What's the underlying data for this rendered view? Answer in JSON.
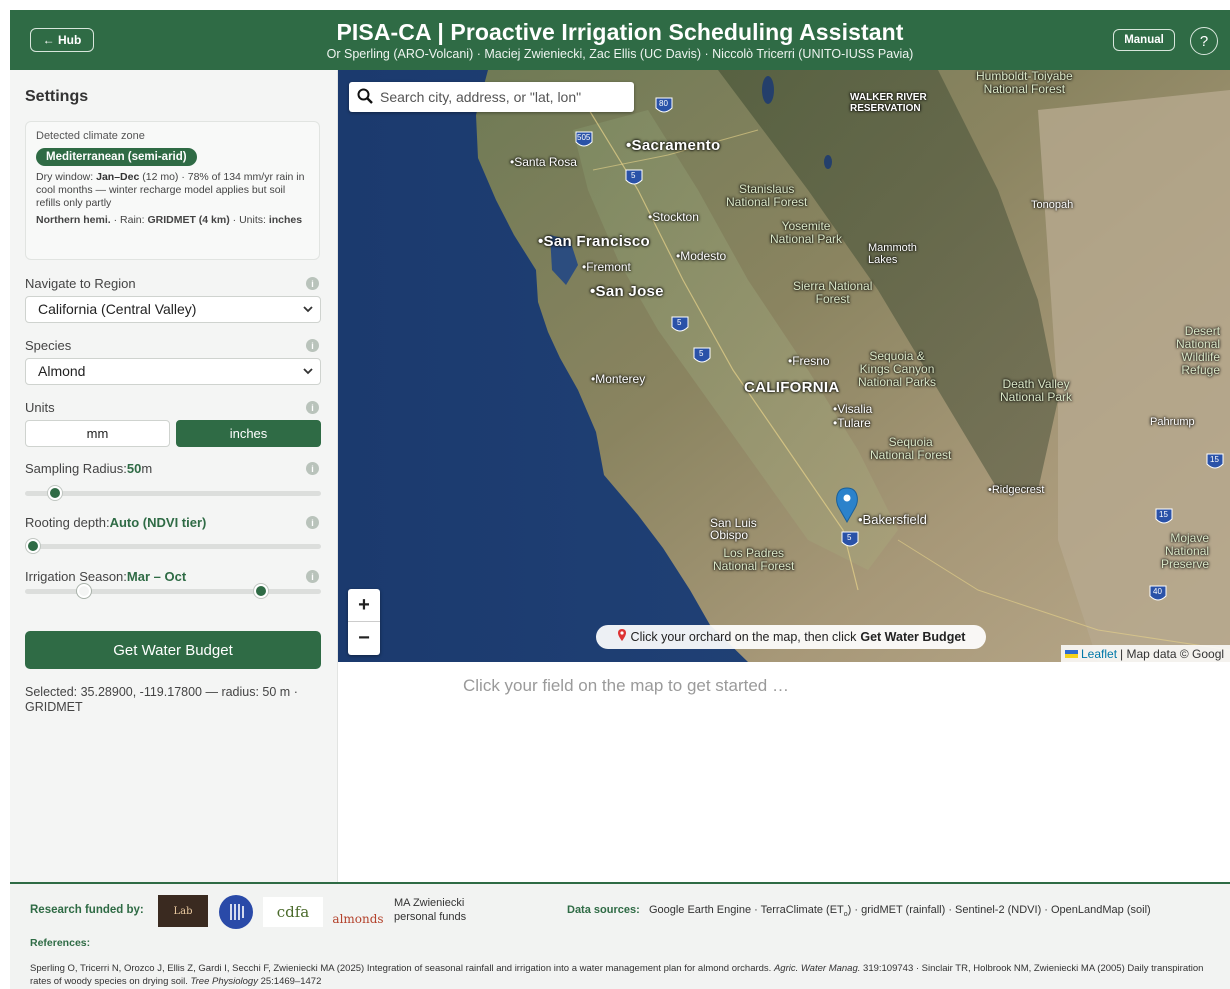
{
  "header": {
    "hub_label": "← Hub",
    "title": "PISA-CA | Proactive Irrigation Scheduling Assistant",
    "subtitle": "Or Sperling (ARO-Volcani) · Maciej Zwieniecki, Zac Ellis (UC Davis) · Niccolò Tricerri (UNITO-IUSS Pavia)",
    "manual_label": "Manual",
    "help_label": "?"
  },
  "sidebar": {
    "title": "Settings",
    "climate": {
      "label": "Detected climate zone",
      "zone": "Mediterranean (semi-arid)",
      "dry_window_label": "Dry window:",
      "dry_window_value": "Jan–Dec",
      "description": "(12 mo) · 78% of 134 mm/yr rain in cool months — winter recharge model applies but soil refills only partly",
      "hemisphere": "Northern hemi.",
      "rain_label": "· Rain:",
      "rain_value": "GRIDMET (4 km)",
      "units_label": "· Units:",
      "units_value": "inches"
    },
    "region": {
      "label": "Navigate to Region",
      "value": "California (Central Valley)"
    },
    "species": {
      "label": "Species",
      "value": "Almond"
    },
    "units": {
      "label": "Units",
      "options": [
        "mm",
        "inches"
      ],
      "selected": "inches"
    },
    "sampling": {
      "label": "Sampling Radius:",
      "value": "50",
      "unit": "m",
      "level": 0.1
    },
    "rooting": {
      "label": "Rooting depth:",
      "value": "Auto (NDVI tier)",
      "level": 0.0
    },
    "season": {
      "label": "Irrigation Season:",
      "value": "Mar – Oct",
      "start_level": 0.18,
      "end_level": 0.82
    },
    "info_glyph": "i",
    "get_button": "Get Water Budget",
    "selected_text": "Selected: 35.28900, -119.17800 — radius: 50 m · GRIDMET"
  },
  "map": {
    "search_placeholder": "Search city, address, or \"lat, lon\"",
    "zoom_in": "+",
    "zoom_out": "−",
    "hint_prefix": "Click your orchard on the map, then click",
    "hint_bold": "Get Water Budget",
    "attribution_leaflet": "Leaflet",
    "attribution_data": "| Map data © Googl",
    "labels": {
      "sacramento": "•Sacramento",
      "santa_rosa": "•Santa Rosa",
      "stockton": "•Stockton",
      "san_francisco": "•San Francisco",
      "modesto": "•Modesto",
      "fremont": "•Fremont",
      "san_jose": "•San Jose",
      "monterey": "•Monterey",
      "fresno": "•Fresno",
      "california": "CALIFORNIA",
      "visalia": "•Visalia",
      "tulare": "•Tulare",
      "bakersfield": "•Bakersfield",
      "san_luis_obispo": "San Luis\nObispo",
      "los_padres": "Los Padres\nNational Forest",
      "stanislaus": "Stanislaus\nNational Forest",
      "yosemite": "Yosemite\nNational Park",
      "mammoth": "Mammoth\nLakes",
      "sierra": "Sierra National\nForest",
      "sequoia_kings": "Sequoia &\nKings Canyon\nNational Parks",
      "sequoia_nf": "Sequoia\nNational Forest",
      "death_valley": "Death Valley\nNational Park",
      "walker_river": "WALKER RIVER\nRESERVATION",
      "humboldt": "Humboldt-Toiyabe\nNational Forest",
      "tonopah": "Tonopah",
      "desert": "Desert\nNational\nWildlife\nRefuge",
      "pahrump": "Pahrump",
      "ridgecrest": "•Ridgecrest",
      "mojave": "Mojave\nNational\nPreserve"
    },
    "highway_labels": {
      "i80": "80",
      "i505": "505",
      "i5_north": "5",
      "i5_mid": "5",
      "i5_south": "5",
      "i5_kern": "5",
      "i15": "15",
      "i15b": "15",
      "i40": "40"
    }
  },
  "main": {
    "empty_text": "Click your field on the map to get started …"
  },
  "footer": {
    "funded_label": "Research funded by:",
    "logos": {
      "lab": "Lab",
      "cdfa": "cdfa",
      "almonds": "almonds"
    },
    "personal_funds": "MA Zwieniecki\npersonal funds",
    "data_sources_label": "Data sources:",
    "data_sources": "Google Earth Engine · TerraClimate (ET",
    "data_sources_sub": "o",
    "data_sources_rest": ") · gridMET (rainfall) · Sentinel-2 (NDVI) · OpenLandMap (soil)",
    "references_label": "References:",
    "ref1_text": "Sperling O, Tricerri N, Orozco J, Ellis Z, Gardi I, Secchi F, Zwieniecki MA (2025) Integration of seasonal rainfall and irrigation into a water management plan for almond orchards.",
    "ref1_journal": "Agric. Water Manag.",
    "ref1_tail": "319:109743 · Sinclair TR, Holbrook NM, Zwieniecki MA (2005) Daily transpiration rates of woody species on drying soil.",
    "ref2_journal": "Tree Physiology",
    "ref2_tail": "25:1469–1472"
  }
}
